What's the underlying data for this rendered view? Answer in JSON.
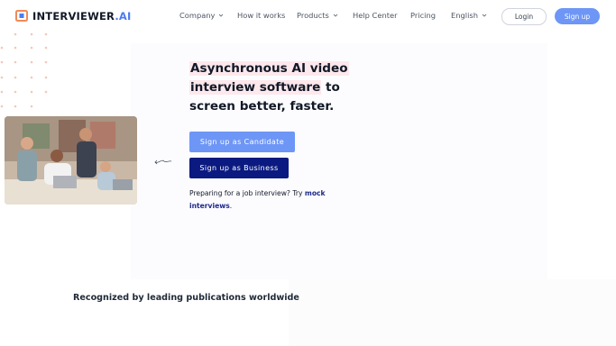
{
  "brand": {
    "name_main": "INTERVIEWER",
    "name_accent": ".AI",
    "logo_icon": "interviewer-logo-icon"
  },
  "nav": {
    "items": [
      {
        "label": "Company",
        "dropdown": true
      },
      {
        "label": "How it works",
        "dropdown": false
      },
      {
        "label": "Products",
        "dropdown": true
      },
      {
        "label": "Help Center",
        "dropdown": false
      },
      {
        "label": "Pricing",
        "dropdown": false
      },
      {
        "label": "English",
        "dropdown": true
      }
    ],
    "login_label": "Login",
    "signup_label": "Sign up"
  },
  "hero": {
    "headline_part1": "Asynchronous AI video",
    "headline_part2": "interview software",
    "headline_part3": " to",
    "headline_part4": "screen better, faster.",
    "cta_candidate": "Sign up as Candidate",
    "cta_business": "Sign up as Business",
    "prep_text": "Preparing for a job interview? Try ",
    "prep_link": "mock interviews",
    "prep_end": "."
  },
  "recognized": {
    "heading": "Recognized by leading publications worldwide"
  },
  "colors": {
    "primary": "#6d96f6",
    "navy": "#0a1a80",
    "highlight": "#fde8ec",
    "logo_orange": "#f08a5a",
    "logo_blue": "#4c7cf0"
  }
}
